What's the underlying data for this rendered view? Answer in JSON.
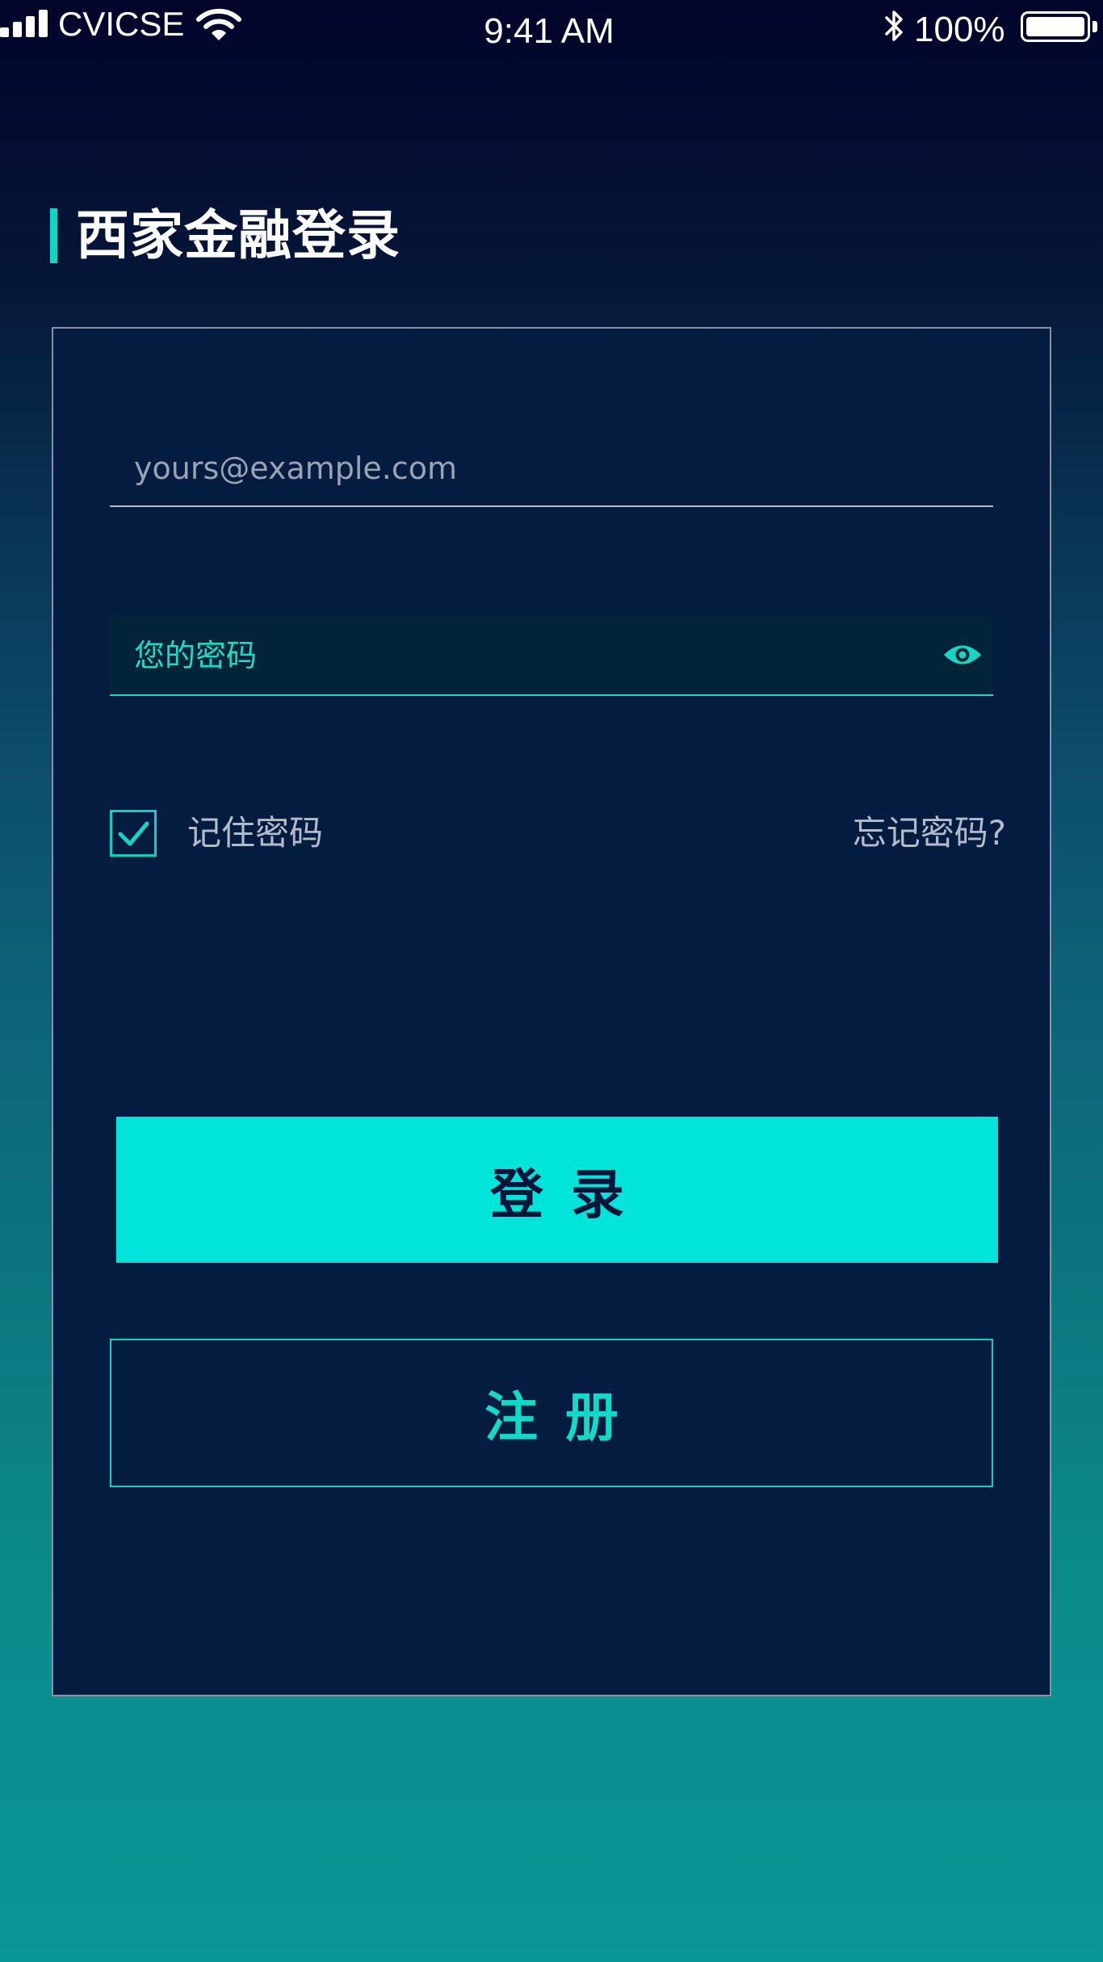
{
  "status_bar": {
    "carrier": "CVICSE",
    "time": "9:41 AM",
    "battery": "100%",
    "icons": [
      "signal-icon",
      "wifi-icon",
      "bluetooth-icon",
      "battery-icon"
    ]
  },
  "title": "西家金融登录",
  "form": {
    "email": {
      "value": "",
      "placeholder": "yours@example.com"
    },
    "password": {
      "value": "",
      "placeholder": "您的密码",
      "icon": "eye-icon"
    },
    "remember": {
      "checked": true,
      "label": "记住密码"
    },
    "forgot_label": "忘记密码?",
    "login_label": "登录",
    "register_label": "注册"
  },
  "colors": {
    "accent": "#00e4d9",
    "accent_text": "#18dcc6",
    "card_background": "#031c40",
    "login_text": "#02163c"
  }
}
